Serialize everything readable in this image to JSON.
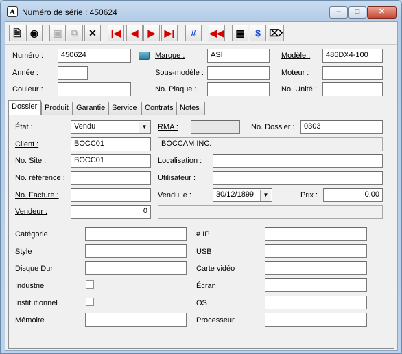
{
  "window": {
    "title": "Numéro de série : 450624"
  },
  "toolbar": {
    "buttons": [
      "new-icon",
      "find-icon",
      "save-icon",
      "copy-icon",
      "delete-icon",
      "first-icon",
      "previous-icon",
      "next-icon",
      "last-icon",
      "renumber-icon",
      "back-icon",
      "counter-icon",
      "values-icon",
      "attachment-icon"
    ]
  },
  "header": {
    "numero_label": "Numéro :",
    "numero_value": "450624",
    "marque_label": "Marque :",
    "marque_value": "ASI",
    "modele_label": "Modèle :",
    "modele_value": "486DX4-100",
    "annee_label": "Année :",
    "annee_value": "",
    "sous_modele_label": "Sous-modèle :",
    "sous_modele_value": "",
    "moteur_label": "Moteur :",
    "moteur_value": "",
    "couleur_label": "Couleur :",
    "couleur_value": "",
    "no_plaque_label": "No. Plaque :",
    "no_plaque_value": "",
    "no_unite_label": "No. Unité :",
    "no_unite_value": ""
  },
  "tabs": [
    "Dossier",
    "Produit",
    "Garantie",
    "Service",
    "Contrats",
    "Notes"
  ],
  "dossier": {
    "etat_label": "État :",
    "etat_value": "Vendu",
    "rma_label": "RMA :",
    "rma_value": "",
    "no_dossier_label": "No. Dossier :",
    "no_dossier_value": "0303",
    "client_label": "Client :",
    "client_value": "BOCC01",
    "client_name": "BOCCAM INC.",
    "no_site_label": "No. Site :",
    "no_site_value": "BOCC01",
    "localisation_label": "Localisation :",
    "localisation_value": "",
    "no_reference_label": "No. référence :",
    "no_reference_value": "",
    "utilisateur_label": "Utilisateur :",
    "utilisateur_value": "",
    "no_facture_label": "No. Facture :",
    "no_facture_value": "",
    "vendu_le_label": "Vendu le :",
    "vendu_le_value": "30/12/1899",
    "prix_label": "Prix :",
    "prix_value": "0.00",
    "vendeur_label": "Vendeur :",
    "vendeur_value": "0",
    "vendeur_name": ""
  },
  "specs": {
    "categorie_label": "Catégorie",
    "categorie_value": "",
    "style_label": "Style",
    "style_value": "",
    "disque_dur_label": "Disque Dur",
    "disque_dur_value": "",
    "industriel_label": "Industriel",
    "institutionnel_label": "Institutionnel",
    "memoire_label": "Mémoire",
    "memoire_value": "",
    "ip_label": "# IP",
    "ip_value": "",
    "usb_label": "USB",
    "usb_value": "",
    "carte_video_label": "Carte vidéo",
    "carte_video_value": "",
    "ecran_label": "Écran",
    "ecran_value": "",
    "os_label": "OS",
    "os_value": "",
    "processeur_label": "Processeur",
    "processeur_value": ""
  }
}
